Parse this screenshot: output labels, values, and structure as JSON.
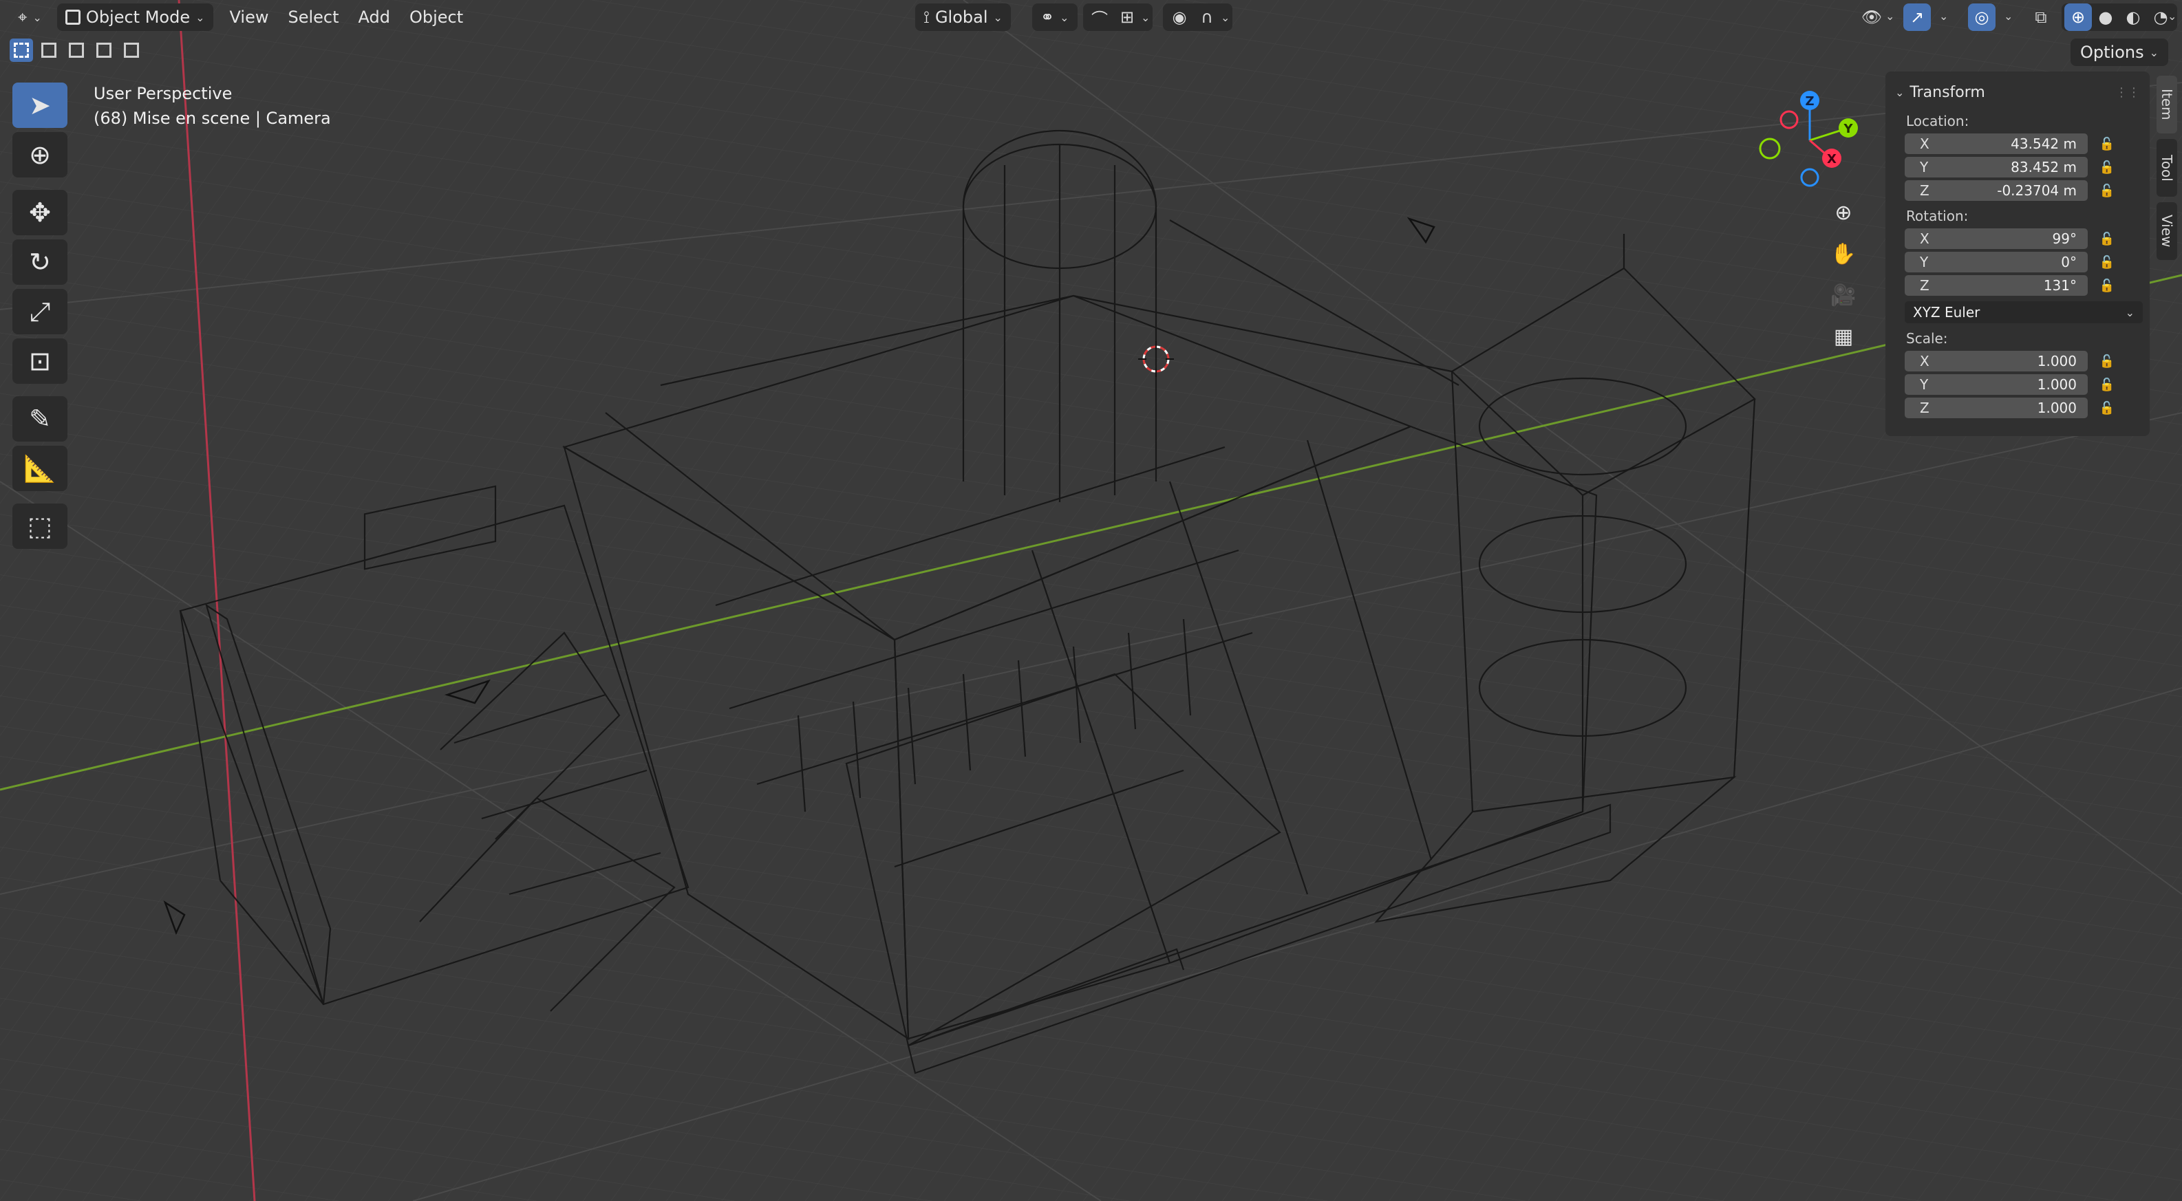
{
  "header": {
    "mode_label": "Object Mode",
    "menus": [
      "View",
      "Select",
      "Add",
      "Object"
    ],
    "transform_orientation": "Global",
    "options_label": "Options"
  },
  "viewport": {
    "view_name": "User Perspective",
    "collection_info": "(68) Mise en scene | Camera"
  },
  "gizmo": {
    "axes": [
      "Z",
      "Y",
      "X"
    ],
    "colors": {
      "x": "#ff3352",
      "y": "#8bdc00",
      "z": "#2890ff"
    }
  },
  "npanel": {
    "title": "Transform",
    "location_label": "Location:",
    "location": [
      {
        "axis": "X",
        "value": "43.542 m"
      },
      {
        "axis": "Y",
        "value": "83.452 m"
      },
      {
        "axis": "Z",
        "value": "-0.23704 m"
      }
    ],
    "rotation_label": "Rotation:",
    "rotation": [
      {
        "axis": "X",
        "value": "99°"
      },
      {
        "axis": "Y",
        "value": "0°"
      },
      {
        "axis": "Z",
        "value": "131°"
      }
    ],
    "rotation_mode": "XYZ Euler",
    "scale_label": "Scale:",
    "scale": [
      {
        "axis": "X",
        "value": "1.000"
      },
      {
        "axis": "Y",
        "value": "1.000"
      },
      {
        "axis": "Z",
        "value": "1.000"
      }
    ],
    "tabs": [
      "Item",
      "Tool",
      "View"
    ]
  },
  "colors": {
    "accent": "#4772b3",
    "viewport_bg": "#3a3a3a",
    "panel_bg": "#303030",
    "x_axis_line": "#b3364a",
    "y_axis_line": "#6d9a2b"
  }
}
